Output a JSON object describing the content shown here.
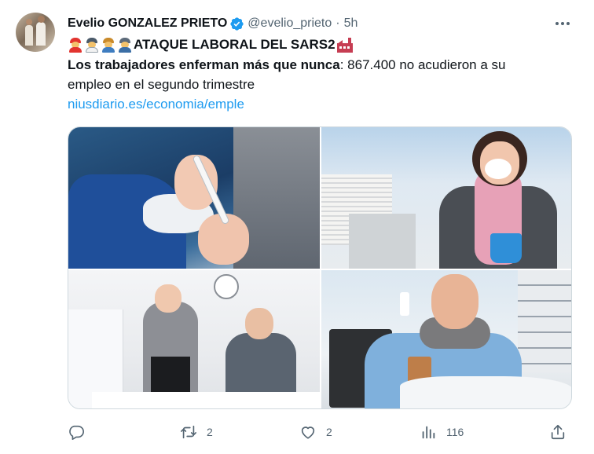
{
  "author": {
    "name": "Evelio GONZALEZ PRIETO",
    "handle": "@evelio_prieto",
    "separator": "·",
    "time": "5h",
    "verified": true
  },
  "tweet": {
    "headline": "ATAQUE LABORAL DEL SARS2",
    "headline_emojis": [
      "firefighter-emoji",
      "health-worker-emoji",
      "farmer-emoji",
      "factory-worker-emoji"
    ],
    "headline_trailing_emoji": "factory-emoji",
    "bold_text": "Los trabajadores enferman más que nunca",
    "rest_text": ": 867.400 no acudieron a su",
    "line3_text": "empleo en el segundo trimestre",
    "link_text": "niusdiario.es/economia/emple"
  },
  "media": [
    {
      "icon": "thermometer-photo"
    },
    {
      "icon": "office-woman-tissue-photo"
    },
    {
      "icon": "office-coworkers-masks-photo"
    },
    {
      "icon": "man-nasal-spray-photo"
    }
  ],
  "actions": {
    "reply_count": "",
    "retweet_count": "2",
    "like_count": "2",
    "views_count": "116"
  },
  "colors": {
    "text": "#0f1419",
    "secondary": "#536471",
    "link": "#1d9bf0",
    "verified": "#1d9bf0",
    "border": "#cfd9de"
  }
}
